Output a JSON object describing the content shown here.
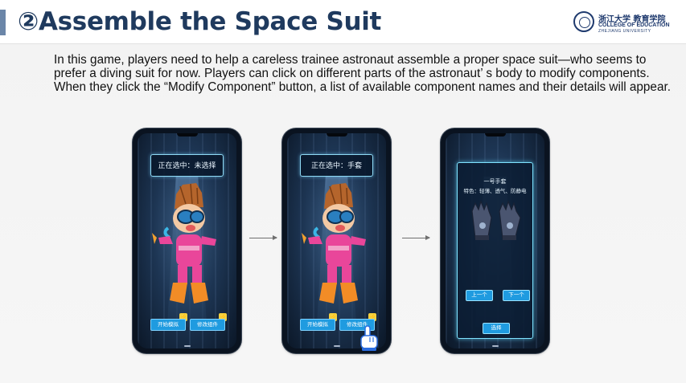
{
  "header": {
    "title": "②Assemble the Space Suit",
    "logo": {
      "cn": "浙江大学 教育学院",
      "en_line1": "COLLEGE OF EDUCATION",
      "en_line2": "ZHEJIANG UNIVERSITY"
    }
  },
  "description": "In this game, players need to help a careless trainee astronaut assemble a proper space suit—who seems to prefer a diving suit for now. Players can click on different parts of the astronaut’ s body to modify components. When they click the “Modify Component” button, a list of available component names and their details will appear.",
  "phones": [
    {
      "status": "正在选中：未选择",
      "start_button": "开始模拟",
      "modify_button": "修改组件"
    },
    {
      "status": "正在选中：手套",
      "start_button": "开始模拟",
      "modify_button": "修改组件"
    },
    {
      "panel_name": "一号手套",
      "panel_feature": "特色：轻薄、透气、防静电",
      "prev_button": "上一个",
      "next_button": "下一个",
      "select_button": "选择"
    }
  ],
  "colors": {
    "title": "#1f3a5e",
    "accent_bar": "#6b86a8",
    "ui_button": "#1f9be0",
    "ui_glow": "#8fdaf5"
  },
  "icons": [
    "lightning-icon",
    "pointer-hand-icon",
    "arrow-right-icon"
  ]
}
